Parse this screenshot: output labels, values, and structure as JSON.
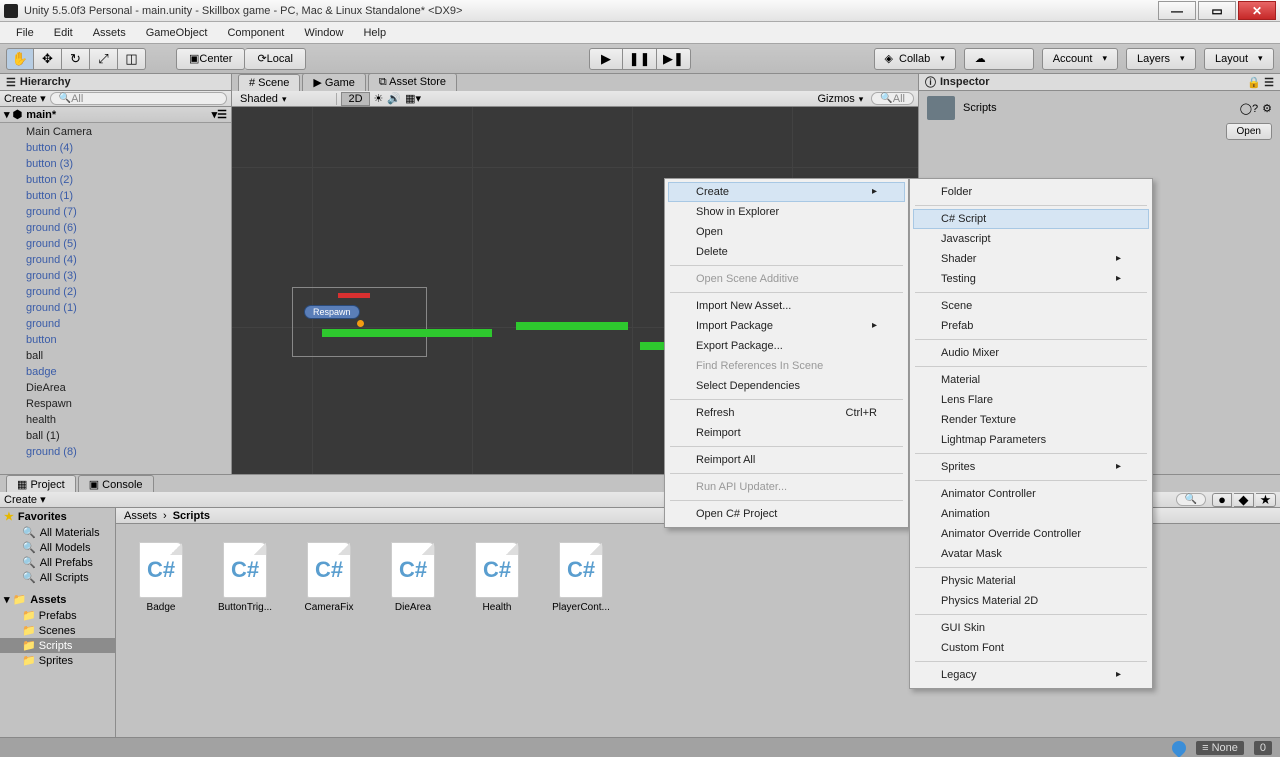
{
  "window": {
    "title": "Unity 5.5.0f3 Personal - main.unity - Skillbox game - PC, Mac & Linux Standalone* <DX9>"
  },
  "menubar": [
    "File",
    "Edit",
    "Assets",
    "GameObject",
    "Component",
    "Window",
    "Help"
  ],
  "toolbar": {
    "center": "Center",
    "local": "Local",
    "collab": "Collab",
    "account": "Account",
    "layers": "Layers",
    "layout": "Layout"
  },
  "hierarchy": {
    "tab": "Hierarchy",
    "create": "Create",
    "search_placeholder": "All",
    "scene": "main*",
    "items": [
      {
        "label": "Main Camera",
        "cls": "black"
      },
      {
        "label": "button (4)"
      },
      {
        "label": "button (3)"
      },
      {
        "label": "button (2)"
      },
      {
        "label": "button (1)"
      },
      {
        "label": "ground (7)"
      },
      {
        "label": "ground (6)"
      },
      {
        "label": "ground (5)"
      },
      {
        "label": "ground (4)"
      },
      {
        "label": "ground (3)"
      },
      {
        "label": "ground (2)"
      },
      {
        "label": "ground (1)"
      },
      {
        "label": "ground"
      },
      {
        "label": "button"
      },
      {
        "label": "ball",
        "cls": "black"
      },
      {
        "label": "badge"
      },
      {
        "label": "DieArea",
        "cls": "black"
      },
      {
        "label": "Respawn",
        "cls": "black"
      },
      {
        "label": "health",
        "cls": "black"
      },
      {
        "label": "ball (1)",
        "cls": "black"
      },
      {
        "label": "ground (8)"
      }
    ]
  },
  "scene_tabs": [
    {
      "label": "Scene",
      "active": true,
      "icon": "#"
    },
    {
      "label": "Game",
      "active": false,
      "icon": "▶"
    },
    {
      "label": "Asset Store",
      "active": false,
      "icon": "⧉"
    }
  ],
  "scene_toolbar": {
    "shaded": "Shaded",
    "mode2d": "2D",
    "gizmos": "Gizmos",
    "search": "All"
  },
  "scene_tag": "Respawn",
  "inspector": {
    "tab": "Inspector",
    "title": "Scripts",
    "open": "Open"
  },
  "project": {
    "tab_project": "Project",
    "tab_console": "Console",
    "create": "Create",
    "favorites": "Favorites",
    "favs": [
      "All Materials",
      "All Models",
      "All Prefabs",
      "All Scripts"
    ],
    "assets_head": "Assets",
    "folders": [
      "Prefabs",
      "Scenes",
      "Scripts",
      "Sprites"
    ],
    "selected_folder": "Scripts",
    "breadcrumb": [
      "Assets",
      "Scripts"
    ],
    "assets": [
      "Badge",
      "ButtonTrig...",
      "CameraFix",
      "DieArea",
      "Health",
      "PlayerCont..."
    ],
    "status_path": "Scripts"
  },
  "ctx1": [
    {
      "label": "Create",
      "type": "highlight sub"
    },
    {
      "label": "Show in Explorer"
    },
    {
      "label": "Open"
    },
    {
      "label": "Delete"
    },
    {
      "type": "sep"
    },
    {
      "label": "Open Scene Additive",
      "type": "disabled"
    },
    {
      "type": "sep"
    },
    {
      "label": "Import New Asset..."
    },
    {
      "label": "Import Package",
      "type": "sub"
    },
    {
      "label": "Export Package..."
    },
    {
      "label": "Find References In Scene",
      "type": "disabled"
    },
    {
      "label": "Select Dependencies"
    },
    {
      "type": "sep"
    },
    {
      "label": "Refresh",
      "shortcut": "Ctrl+R"
    },
    {
      "label": "Reimport"
    },
    {
      "type": "sep"
    },
    {
      "label": "Reimport All"
    },
    {
      "type": "sep"
    },
    {
      "label": "Run API Updater...",
      "type": "disabled"
    },
    {
      "type": "sep"
    },
    {
      "label": "Open C# Project"
    }
  ],
  "ctx2": [
    {
      "label": "Folder"
    },
    {
      "type": "sep"
    },
    {
      "label": "C# Script",
      "type": "highlight"
    },
    {
      "label": "Javascript"
    },
    {
      "label": "Shader",
      "type": "sub"
    },
    {
      "label": "Testing",
      "type": "sub"
    },
    {
      "type": "sep"
    },
    {
      "label": "Scene"
    },
    {
      "label": "Prefab"
    },
    {
      "type": "sep"
    },
    {
      "label": "Audio Mixer"
    },
    {
      "type": "sep"
    },
    {
      "label": "Material"
    },
    {
      "label": "Lens Flare"
    },
    {
      "label": "Render Texture"
    },
    {
      "label": "Lightmap Parameters"
    },
    {
      "type": "sep"
    },
    {
      "label": "Sprites",
      "type": "sub"
    },
    {
      "type": "sep"
    },
    {
      "label": "Animator Controller"
    },
    {
      "label": "Animation"
    },
    {
      "label": "Animator Override Controller"
    },
    {
      "label": "Avatar Mask"
    },
    {
      "type": "sep"
    },
    {
      "label": "Physic Material"
    },
    {
      "label": "Physics Material 2D"
    },
    {
      "type": "sep"
    },
    {
      "label": "GUI Skin"
    },
    {
      "label": "Custom Font"
    },
    {
      "type": "sep"
    },
    {
      "label": "Legacy",
      "type": "sub"
    }
  ],
  "statusbar": {
    "layer": "None",
    "count": "0"
  }
}
